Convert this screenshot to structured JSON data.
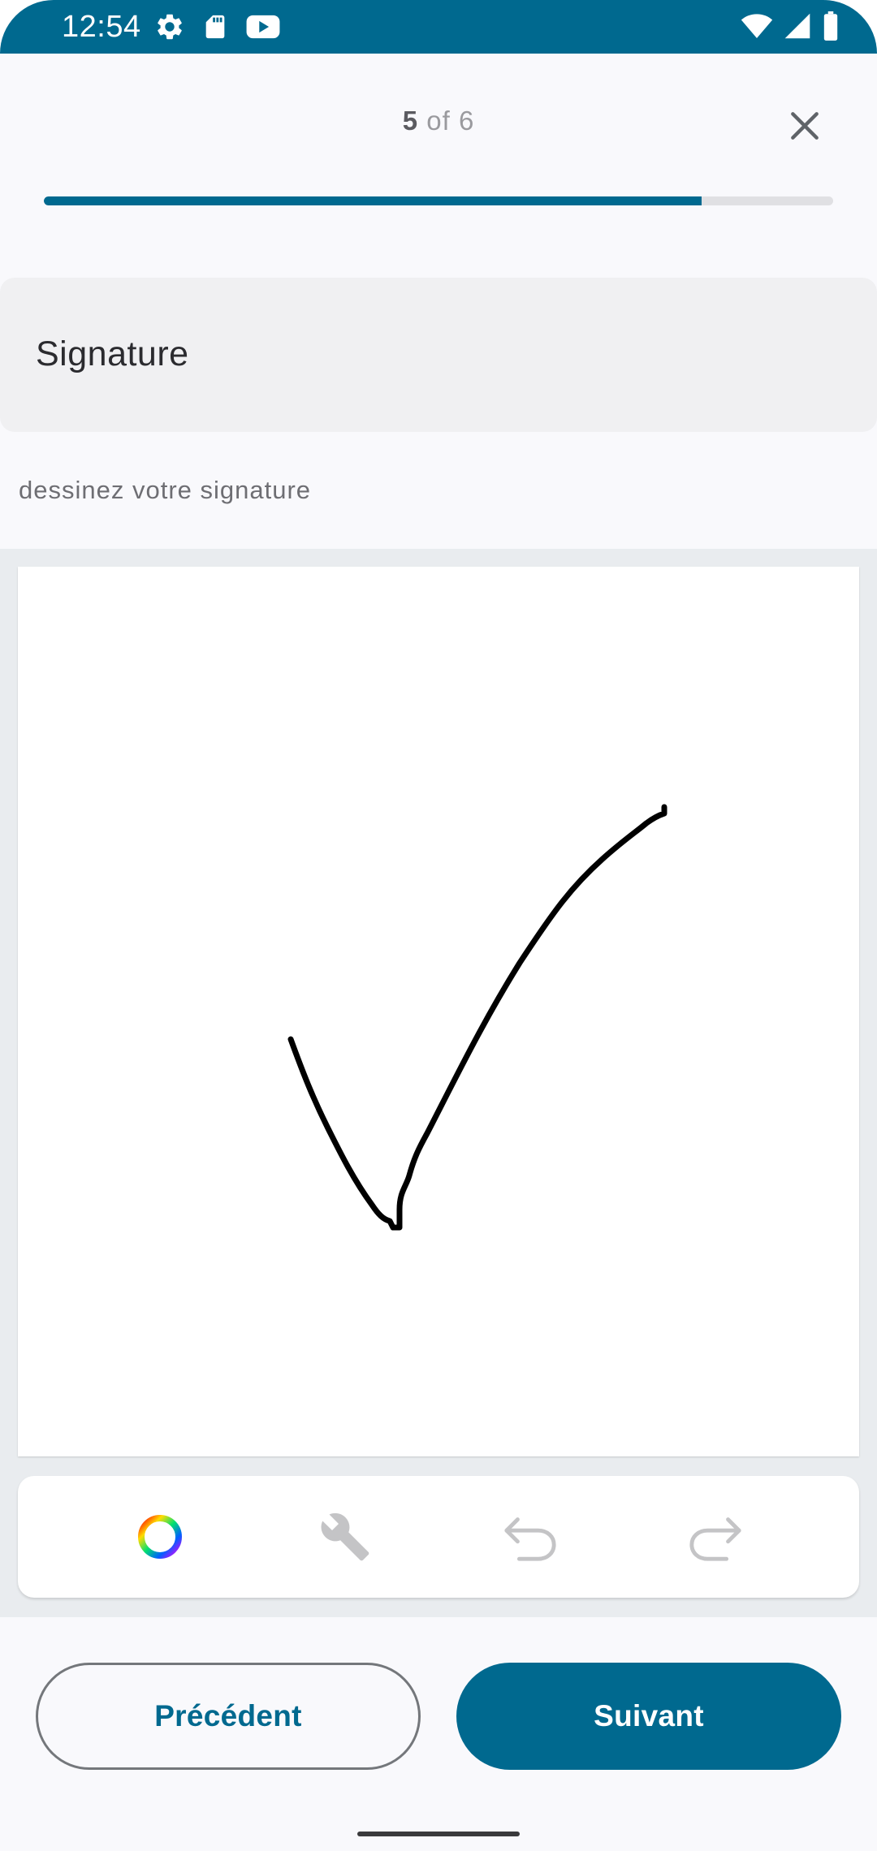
{
  "status_bar": {
    "time": "12:54",
    "left_icons": [
      "settings-icon",
      "sd-card-icon",
      "youtube-icon"
    ],
    "right_icons": [
      "wifi-icon",
      "signal-icon",
      "battery-icon"
    ],
    "color": "#00698f"
  },
  "progress": {
    "current": "5",
    "separator": "of",
    "total": "6",
    "fraction": 0.833
  },
  "header": {
    "close_icon": "close-icon"
  },
  "section": {
    "title": "Signature",
    "instruction": "dessinez votre signature"
  },
  "toolbar": {
    "tools": [
      "color-wheel-icon",
      "wrench-icon",
      "undo-icon",
      "redo-icon"
    ]
  },
  "buttons": {
    "previous": "Précédent",
    "next": "Suivant"
  },
  "colors": {
    "accent": "#00698f",
    "background": "#f9f9fc",
    "title_card": "#f0f0f2",
    "canvas_area": "#e9ecef"
  }
}
